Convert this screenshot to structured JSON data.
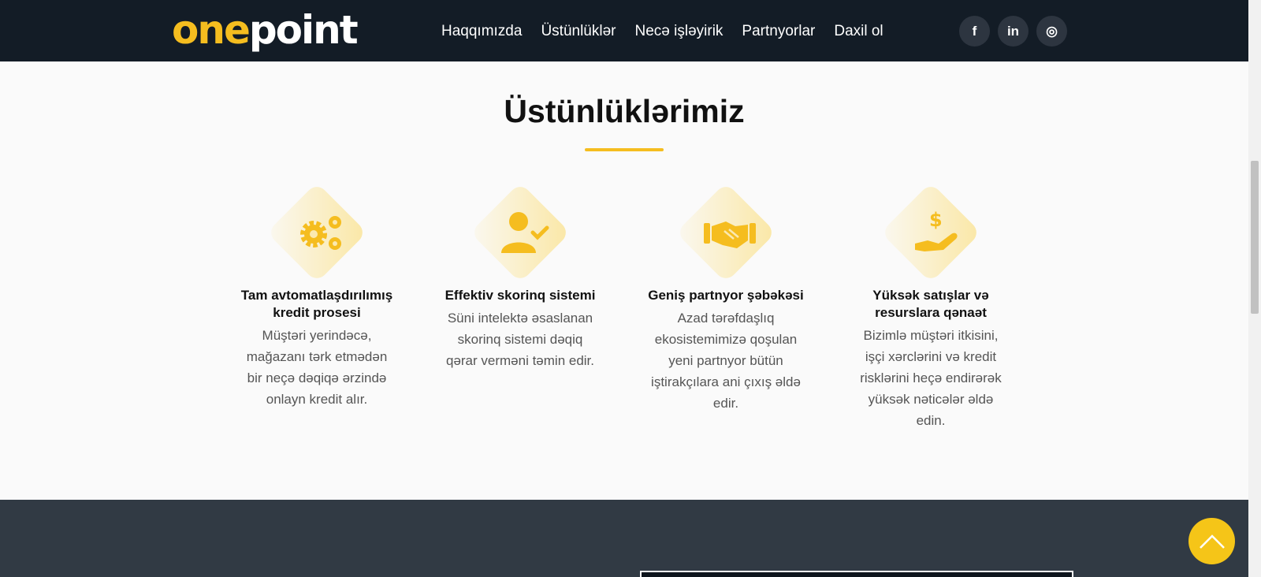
{
  "header": {
    "logo": {
      "part1": "one",
      "part2": "point"
    },
    "nav": [
      "Haqqımızda",
      "Üstünlüklər",
      "Necə işləyirik",
      "Partnyorlar",
      "Daxil ol"
    ],
    "socials": [
      {
        "icon": "facebook-icon",
        "glyph": "f"
      },
      {
        "icon": "linkedin-icon",
        "glyph": "in"
      },
      {
        "icon": "instagram-icon",
        "glyph": "◎"
      }
    ]
  },
  "section": {
    "title": "Üstünlüklərimiz",
    "features": [
      {
        "icon": "gears-icon",
        "title": "Tam avtomatlaşdırılımış kredit prosesi",
        "text": "Müştəri yerindəcə, mağazanı tərk etmədən bir neçə dəqiqə ərzində onlayn kredit alır."
      },
      {
        "icon": "user-check-icon",
        "title": "Effektiv skorinq sistemi",
        "text": "Süni intelektə əsaslanan skorinq sistemi dəqiq qərar verməni təmin edir."
      },
      {
        "icon": "handshake-icon",
        "title": "Geniş partnyor şəbəkəsi",
        "text": "Azad tərəfdaşlıq ekosistemimizə qoşulan yeni partnyor bütün iştirakçılara ani çıxış əldə edir."
      },
      {
        "icon": "hand-dollar-icon",
        "title": "Yüksək satışlar və resurslara qənaət",
        "text": "Bizimlə müştəri itkisini, işçi xərclərini və kredit risklərini heçə endirərək yüksək nəticələr əldə edin."
      }
    ]
  },
  "colors": {
    "accent": "#f5bd1f",
    "header_bg": "#131c26",
    "footer_bg": "#313a44"
  }
}
